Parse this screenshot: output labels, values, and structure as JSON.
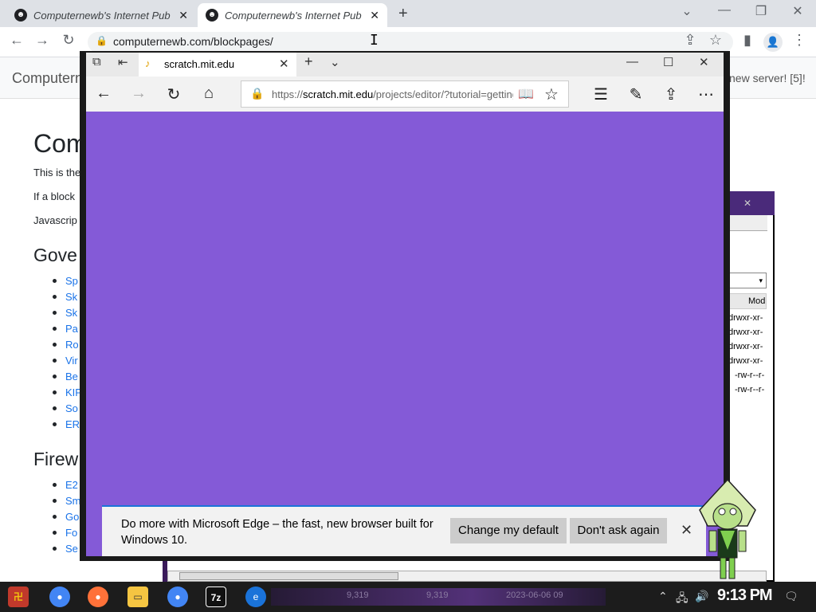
{
  "chrome": {
    "tabs": [
      {
        "title": "Computernewb's Internet Pub"
      },
      {
        "title": "Computernewb's Internet Pub"
      }
    ],
    "new_tab": "+",
    "url": "computernewb.com/blockpages/",
    "window_controls": {
      "minimize": "—",
      "restore": "❐",
      "close": "✕",
      "dropdown": "⌄"
    }
  },
  "page": {
    "brand": "Computern",
    "news": "new server! [5]!",
    "h1": "Com",
    "p1": "This is the",
    "p2": "If a block",
    "p3": "Javascrip",
    "h2_1": "Gove",
    "list_1": [
      "Sp",
      "Sk",
      "Sk",
      "Pa",
      "Ro",
      "Vir",
      "Be",
      "KIF",
      "So",
      "ER"
    ],
    "h2_2": "Firew",
    "list_2": [
      "E2",
      "Sm",
      "Go",
      "Fo",
      "Se"
    ]
  },
  "edge": {
    "tab_title": "scratch.mit.edu",
    "url_prefix": "https://",
    "url_domain": "scratch.mit.edu",
    "url_rest": "/projects/editor/?tutorial=getting",
    "content_color": "#845ad7",
    "infobar": {
      "message": "Do more with Microsoft Edge – the fast, new browser built for Windows 10.",
      "change_default": "Change my default",
      "dont_ask": "Don't ask again"
    }
  },
  "file_manager": {
    "column": "Mod",
    "rows": [
      "drwxr-xr-",
      "drwxr-xr-",
      "drwxr-xr-",
      "drwxr-xr-",
      "-rw-r--r-",
      "-rw-r--r-"
    ]
  },
  "taskbar": {
    "clock": "9:13 PM",
    "ghost_1": "9,319",
    "ghost_2": "9,319",
    "ghost_3": "2023-06-06 09"
  }
}
